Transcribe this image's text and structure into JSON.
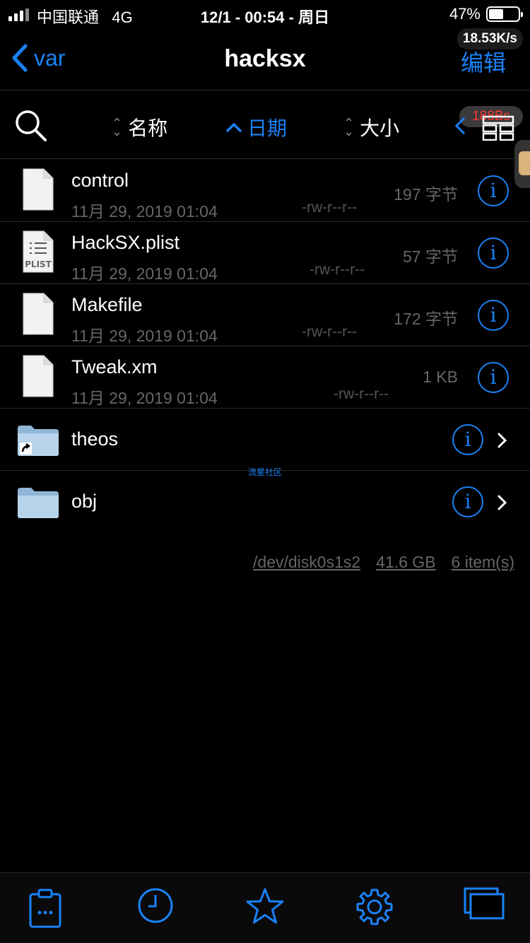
{
  "status_bar": {
    "carrier": "中国联通",
    "network": "4G",
    "time": "12/1 - 00:54 - 周日",
    "battery": "47%",
    "battery_level": 0.47,
    "net_speed": "18.53K/s"
  },
  "nav": {
    "back_label": "var",
    "title": "hacksx",
    "edit_label": "编辑"
  },
  "sort_bar": {
    "name_label": "名称",
    "date_label": "日期",
    "size_label": "大小",
    "badge": "188Bs"
  },
  "files": [
    {
      "name": "control",
      "date": "11月 29, 2019 01:04",
      "perm": "-rw-r--r--",
      "size": "197 字节",
      "icon": "document-icon"
    },
    {
      "name": "HackSX.plist",
      "date": "11月 29, 2019 01:04",
      "perm": "-rw-r--r--",
      "size": "57 字节",
      "icon": "plist-icon",
      "icon_text": "PLIST"
    },
    {
      "name": "Makefile",
      "date": "11月 29, 2019 01:04",
      "perm": "-rw-r--r--",
      "size": "172 字节",
      "icon": "document-icon"
    },
    {
      "name": "Tweak.xm",
      "date": "11月 29, 2019 01:04",
      "perm": "-rw-r--r--",
      "size": "1 KB",
      "icon": "document-icon"
    }
  ],
  "folders": [
    {
      "name": "theos",
      "icon": "folder-alias-icon"
    },
    {
      "name": "obj",
      "icon": "folder-icon"
    }
  ],
  "watermark": "流星社区",
  "footer": {
    "disk": "/dev/disk0s1s2",
    "free": "41.6 GB",
    "count": "6 item(s)"
  },
  "tabs": [
    "clipboard-icon",
    "clock-icon",
    "star-icon",
    "gear-icon",
    "windows-icon"
  ],
  "colors": {
    "accent": "#1a82f7",
    "background": "#000000",
    "secondary_text": "#666666"
  }
}
